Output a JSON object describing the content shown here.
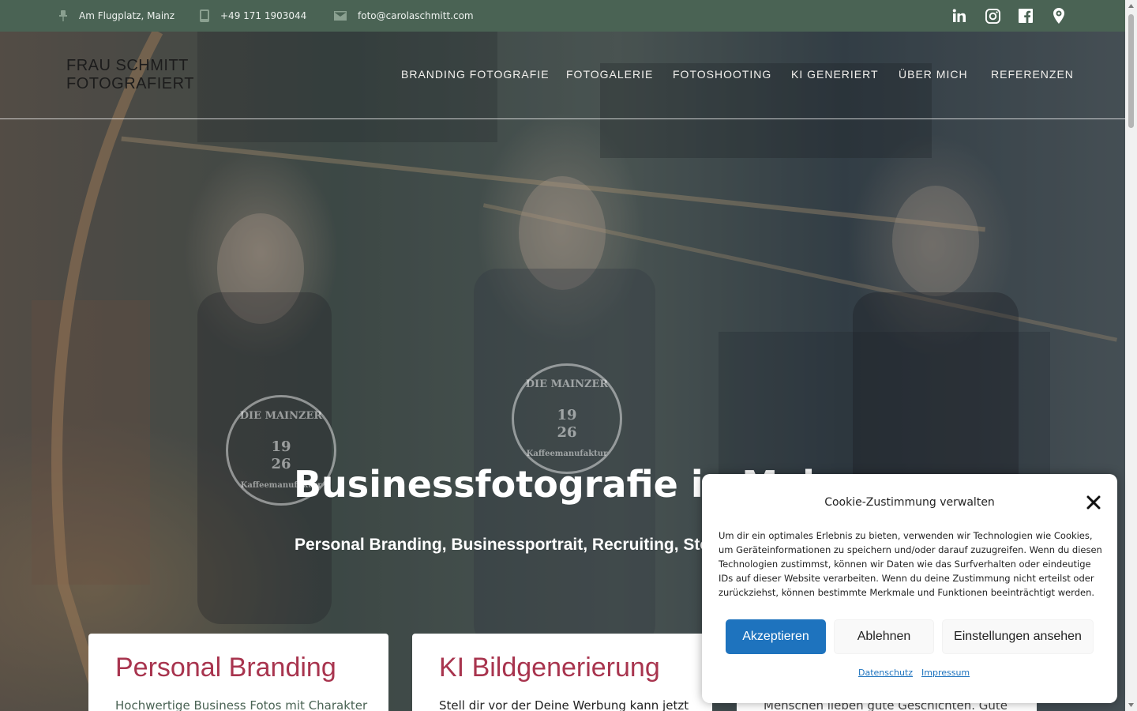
{
  "topbar": {
    "location": "Am Flugplatz, Mainz",
    "phone": "+49 171 1903044",
    "email": "foto@carolaschmitt.com",
    "social_icons": [
      "linkedin-icon",
      "instagram-icon",
      "facebook-icon",
      "map-pin-icon"
    ],
    "background": "#4a6354"
  },
  "header": {
    "logo_line1": "FRAU SCHMITT",
    "logo_line2": "FOTOGRAFIERT",
    "nav": [
      "BRANDING FOTOGRAFIE",
      "FOTOGALERIE",
      "FOTOSHOOTING",
      "KI GENERIERT",
      "ÜBER MICH",
      "REFERENZEN"
    ]
  },
  "hero": {
    "title": "Businessfotografie in Mainz",
    "subtitle": "Personal Branding, Businessportrait, Recruiting, Storytelling",
    "watermark_line1": "DIE MAINZER",
    "watermark_year_top": "19",
    "watermark_year_bottom": "26",
    "watermark_line2": "Kaffeemanufaktur"
  },
  "cards": [
    {
      "title": "Personal Branding",
      "text": "Hochwertige Business Fotos mit Charakter",
      "text_color": "#4a6354"
    },
    {
      "title": "KI Bildgenerierung",
      "text": "Stell dir vor der Deine Werbung kann jetzt",
      "text_color": "#222222"
    },
    {
      "title": "",
      "text": "Menschen lieben gute Geschichten. Gute",
      "text_color": "#444444"
    }
  ],
  "cookie": {
    "title": "Cookie-Zustimmung verwalten",
    "body": "Um dir ein optimales Erlebnis zu bieten, verwenden wir Technologien wie Cookies, um Geräteinformationen zu speichern und/oder darauf zuzugreifen. Wenn du diesen Technologien zustimmst, können wir Daten wie das Surfverhalten oder eindeutige IDs auf dieser Website verarbeiten. Wenn du deine Zustimmung nicht erteilst oder zurückziehst, können bestimmte Merkmale und Funktionen beeinträchtigt werden.",
    "accept": "Akzeptieren",
    "deny": "Ablehnen",
    "preferences": "Einstellungen ansehen",
    "link_privacy": "Datenschutz",
    "link_imprint": "Impressum",
    "accent": "#1e73be"
  },
  "colors": {
    "card_title": "#a8344e"
  }
}
